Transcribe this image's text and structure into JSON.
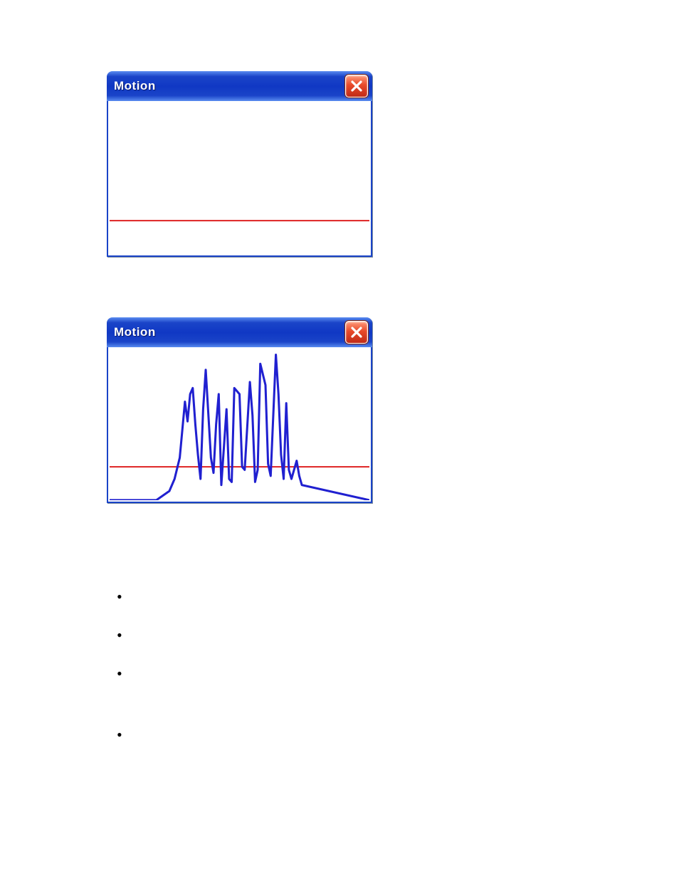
{
  "window_title": "Motion",
  "colors": {
    "threshold": "#e03030",
    "signal": "#2020d0",
    "titlebar_gradient": [
      "#5a8cf0",
      "#1a44c8",
      "#1038c4"
    ],
    "close_gradient": [
      "#ff9b7a",
      "#e84a2a",
      "#c02a16"
    ]
  },
  "chart_data": [
    {
      "type": "line",
      "title": "",
      "xlabel": "",
      "ylabel": "",
      "ylim": [
        0,
        100
      ],
      "threshold_y": 22,
      "series": [
        {
          "name": "motion",
          "x": [],
          "y": []
        }
      ]
    },
    {
      "type": "line",
      "title": "",
      "xlabel": "",
      "ylabel": "",
      "ylim": [
        0,
        100
      ],
      "threshold_y": 22,
      "series": [
        {
          "name": "motion",
          "x": [
            0,
            18,
            23,
            25,
            27,
            29,
            30,
            31,
            32,
            33,
            34,
            35,
            36,
            37,
            39,
            40,
            41,
            42,
            43,
            45,
            46,
            47,
            48,
            50,
            51,
            52,
            54,
            55,
            56,
            57,
            58,
            60,
            61,
            62,
            64,
            65,
            66,
            67,
            68,
            69,
            70,
            72,
            73,
            74,
            100
          ],
          "y": [
            0,
            0,
            6,
            14,
            28,
            65,
            52,
            70,
            74,
            50,
            30,
            14,
            60,
            86,
            28,
            18,
            50,
            70,
            10,
            60,
            14,
            12,
            74,
            70,
            22,
            20,
            78,
            56,
            12,
            20,
            90,
            76,
            24,
            16,
            96,
            70,
            30,
            14,
            64,
            20,
            14,
            26,
            16,
            10,
            0
          ]
        }
      ]
    }
  ],
  "bullets": [
    "",
    "",
    "",
    ""
  ]
}
